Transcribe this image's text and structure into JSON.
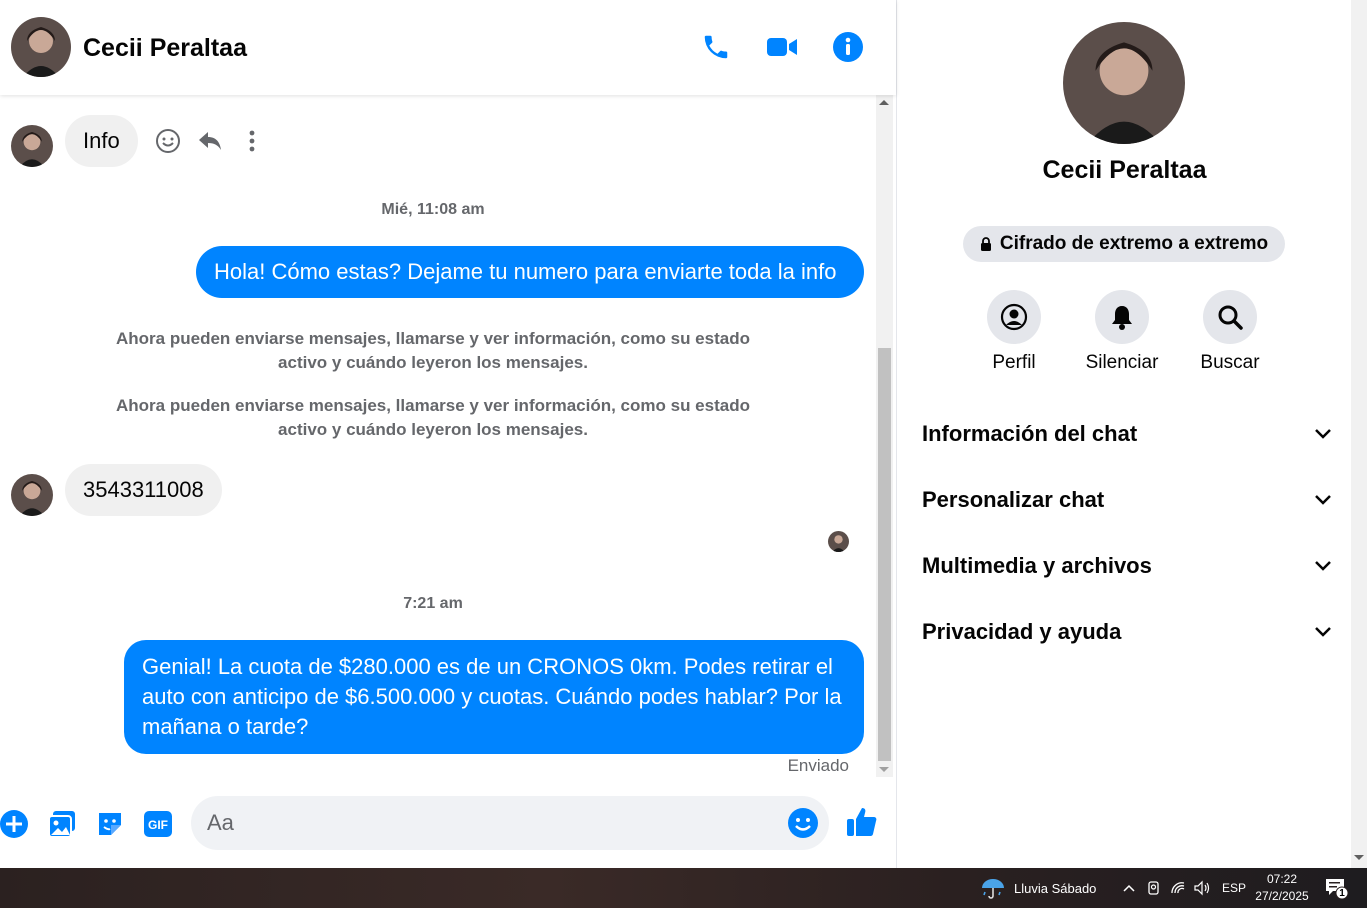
{
  "contact": {
    "name": "Cecii Peraltaa"
  },
  "messages": {
    "first_incoming": "Info",
    "timestamp_1": "Mié, 11:08 am",
    "outgoing_1": "Hola! Cómo estas? Dejame tu numero para enviarte toda la info",
    "system_1": "Ahora pueden enviarse mensajes, llamarse y ver información, como su estado activo y cuándo leyeron los mensajes.",
    "system_2": "Ahora pueden enviarse mensajes, llamarse y ver información, como su estado activo y cuándo leyeron los mensajes.",
    "incoming_number": "3543311008",
    "timestamp_2": "7:21 am",
    "outgoing_2": "Genial! La cuota de $280.000 es de un CRONOS 0km. Podes retirar el auto con anticipo de $6.500.000 y cuotas. Cuándo podes hablar? Por la mañana o tarde?",
    "status": "Enviado"
  },
  "composer": {
    "placeholder": "Aa"
  },
  "info_panel": {
    "encryption": "Cifrado de extremo a extremo",
    "actions": [
      {
        "label": "Perfil",
        "icon": "profile-icon"
      },
      {
        "label": "Silenciar",
        "icon": "bell-icon"
      },
      {
        "label": "Buscar",
        "icon": "search-icon"
      }
    ],
    "sections": [
      {
        "label": "Información del chat"
      },
      {
        "label": "Personalizar chat"
      },
      {
        "label": "Multimedia y archivos"
      },
      {
        "label": "Privacidad y ayuda"
      }
    ]
  },
  "taskbar": {
    "weather": "Lluvia Sábado",
    "language": "ESP",
    "time": "07:22",
    "date": "27/2/2025",
    "notification_count": "1"
  },
  "colors": {
    "accent": "#0084ff",
    "bubble_in": "#f0f0f0",
    "muted_text": "#65676b"
  }
}
